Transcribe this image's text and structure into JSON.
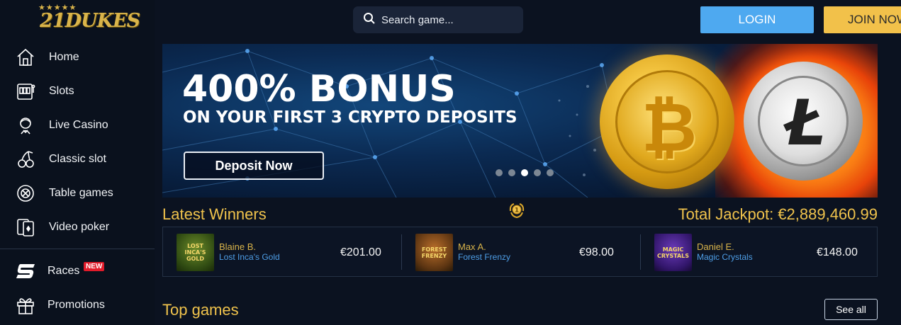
{
  "logo": {
    "text": "21DUKES",
    "stars": "★★★★★"
  },
  "sidebar": {
    "items": [
      {
        "label": "Home",
        "icon": "home-icon"
      },
      {
        "label": "Slots",
        "icon": "slot-machine-icon"
      },
      {
        "label": "Live Casino",
        "icon": "dealer-icon"
      },
      {
        "label": "Classic slot",
        "icon": "cherries-icon"
      },
      {
        "label": "Table games",
        "icon": "chip-icon"
      },
      {
        "label": "Video poker",
        "icon": "cards-icon"
      },
      {
        "label": "Races",
        "icon": "races-icon",
        "badge": "NEW"
      },
      {
        "label": "Promotions",
        "icon": "gift-icon"
      }
    ]
  },
  "header": {
    "search_placeholder": "Search game...",
    "login_label": "LOGIN",
    "join_label": "JOIN NOW"
  },
  "banner": {
    "headline": "400% BONUS",
    "subheadline": "ON YOUR FIRST 3 CRYPTO DEPOSITS",
    "cta_label": "Deposit Now",
    "slides_count": 5,
    "active_slide": 3
  },
  "winners": {
    "title": "Latest Winners",
    "jackpot": "Total Jackpot: €2,889,460.99",
    "items": [
      {
        "name": "Blaine B.",
        "game": "Lost Inca's Gold",
        "amount": "€201.00",
        "thumb_text": "LOST INCA'S GOLD"
      },
      {
        "name": "Max A.",
        "game": "Forest Frenzy",
        "amount": "€98.00",
        "thumb_text": "FOREST FRENZY"
      },
      {
        "name": "Daniel E.",
        "game": "Magic Crystals",
        "amount": "€148.00",
        "thumb_text": "MAGIC CRYSTALS"
      }
    ]
  },
  "top_games": {
    "title": "Top games",
    "see_all_label": "See all"
  },
  "colors": {
    "accent_gold": "#f0c34c",
    "login_blue": "#4ea9f0",
    "join_yellow": "#f2c14a",
    "link_blue": "#4e9ee6",
    "badge_red": "#e21b2a"
  }
}
